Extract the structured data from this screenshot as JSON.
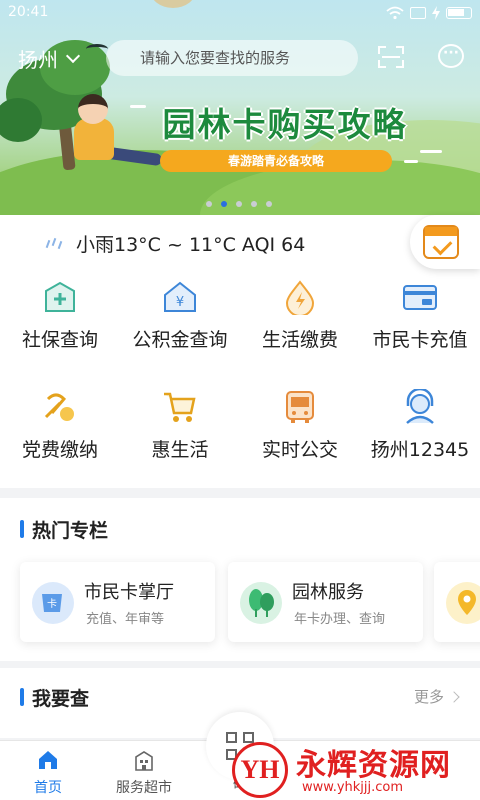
{
  "status_bar": {
    "time": "20:41"
  },
  "header": {
    "city": "扬州",
    "search_placeholder": "请输入您要查找的服务"
  },
  "banner": {
    "title": "园林卡购买攻略",
    "subtitle": "春游踏青必备攻略",
    "page_count": 5,
    "active_page": 2
  },
  "weather": {
    "text": "小雨13°C ~ 11°C AQI 64"
  },
  "services": [
    {
      "label": "社保查询",
      "icon": "social-security-icon"
    },
    {
      "label": "公积金查询",
      "icon": "housing-fund-icon"
    },
    {
      "label": "生活缴费",
      "icon": "utility-payment-icon"
    },
    {
      "label": "市民卡充值",
      "icon": "citizen-card-icon"
    },
    {
      "label": "党费缴纳",
      "icon": "party-fee-icon"
    },
    {
      "label": "惠生活",
      "icon": "shopping-cart-icon"
    },
    {
      "label": "实时公交",
      "icon": "bus-icon"
    },
    {
      "label": "扬州12345",
      "icon": "customer-service-icon"
    }
  ],
  "hot_section": {
    "title": "热门专栏",
    "cards": [
      {
        "title": "市民卡掌厅",
        "subtitle": "充值、年审等"
      },
      {
        "title": "园林服务",
        "subtitle": "年卡办理、查询"
      }
    ]
  },
  "query_section": {
    "title": "我要查",
    "more": "更多"
  },
  "tabbar": {
    "tabs": [
      {
        "label": "首页"
      },
      {
        "label": "服务超市"
      },
      {
        "label": "码"
      }
    ]
  },
  "watermark": {
    "logo": "YH",
    "name": "永辉资源网",
    "url": "www.yhkjjj.com"
  },
  "colors": {
    "accent": "#1f7be8",
    "banner_pill": "#f5a81e",
    "watermark": "#e02020"
  }
}
